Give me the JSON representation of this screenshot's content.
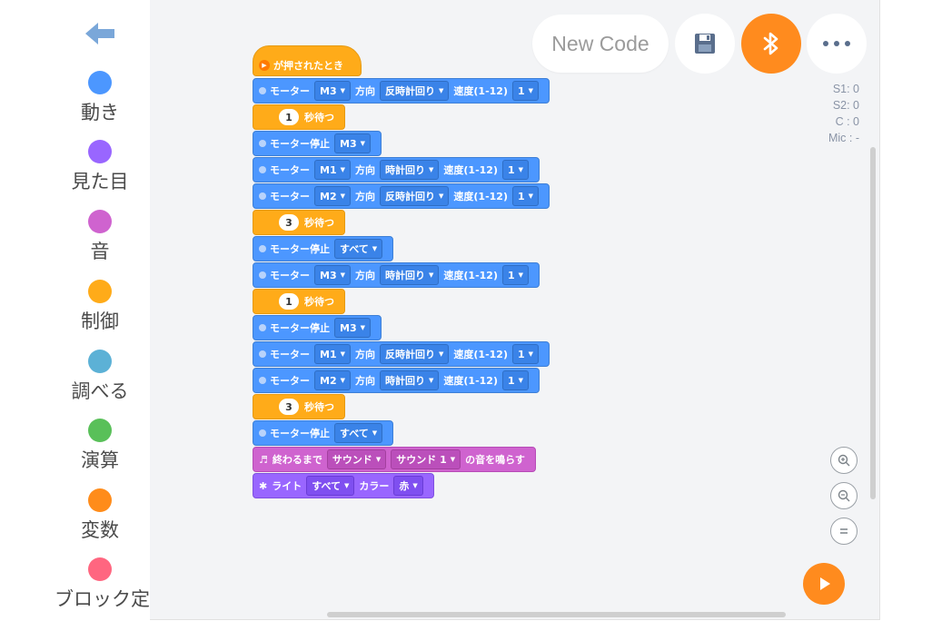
{
  "sidebar": {
    "categories": [
      {
        "label": "動き",
        "color": "#4c97ff"
      },
      {
        "label": "見た目",
        "color": "#9966ff"
      },
      {
        "label": "音",
        "color": "#cf63cf"
      },
      {
        "label": "制御",
        "color": "#ffab19"
      },
      {
        "label": "調べる",
        "color": "#5cb1d6"
      },
      {
        "label": "演算",
        "color": "#59c059"
      },
      {
        "label": "変数",
        "color": "#ff8c1a"
      },
      {
        "label": "ブロック定",
        "color": "#ff6680"
      }
    ]
  },
  "toolbar": {
    "new_code_label": "New Code",
    "icons": [
      "save-icon",
      "bluetooth-icon",
      "more-icon"
    ]
  },
  "sensors": {
    "s1": "S1: 0",
    "s2": "S2: 0",
    "c": "C : 0",
    "mic": "Mic : -"
  },
  "script": {
    "hat_label": "が押されたとき",
    "blocks": [
      {
        "kind": "motor",
        "t1": "モーター",
        "d1": "M3",
        "t2": "方向",
        "d2": "反時計回り",
        "t3": "速度(1-12)",
        "d3": "1"
      },
      {
        "kind": "wait",
        "n": "1",
        "t1": "秒待つ"
      },
      {
        "kind": "stop",
        "t1": "モーター停止",
        "d1": "M3"
      },
      {
        "kind": "motor",
        "t1": "モーター",
        "d1": "M1",
        "t2": "方向",
        "d2": "時計回り",
        "t3": "速度(1-12)",
        "d3": "1"
      },
      {
        "kind": "motor",
        "t1": "モーター",
        "d1": "M2",
        "t2": "方向",
        "d2": "反時計回り",
        "t3": "速度(1-12)",
        "d3": "1"
      },
      {
        "kind": "wait",
        "n": "3",
        "t1": "秒待つ"
      },
      {
        "kind": "stop",
        "t1": "モーター停止",
        "d1": "すべて"
      },
      {
        "kind": "motor",
        "t1": "モーター",
        "d1": "M3",
        "t2": "方向",
        "d2": "時計回り",
        "t3": "速度(1-12)",
        "d3": "1"
      },
      {
        "kind": "wait",
        "n": "1",
        "t1": "秒待つ"
      },
      {
        "kind": "stop",
        "t1": "モーター停止",
        "d1": "M3"
      },
      {
        "kind": "motor",
        "t1": "モーター",
        "d1": "M1",
        "t2": "方向",
        "d2": "反時計回り",
        "t3": "速度(1-12)",
        "d3": "1"
      },
      {
        "kind": "motor",
        "t1": "モーター",
        "d1": "M2",
        "t2": "方向",
        "d2": "時計回り",
        "t3": "速度(1-12)",
        "d3": "1"
      },
      {
        "kind": "wait",
        "n": "3",
        "t1": "秒待つ"
      },
      {
        "kind": "stop",
        "t1": "モーター停止",
        "d1": "すべて"
      },
      {
        "kind": "sound",
        "t1": "終わるまで",
        "d1": "サウンド",
        "d2": "サウンド 1",
        "t2": "の音を鳴らす"
      },
      {
        "kind": "light",
        "t1": "ライト",
        "d1": "すべて",
        "t2": "カラー",
        "d2": "赤"
      }
    ]
  },
  "zoom_controls": [
    "zoom-in-icon",
    "zoom-out-icon",
    "zoom-reset-icon"
  ],
  "colors": {
    "motion": "#4c97ff",
    "control": "#ffab19",
    "sound": "#cf63cf",
    "looks": "#9966ff",
    "accent": "#ff8b1e"
  }
}
